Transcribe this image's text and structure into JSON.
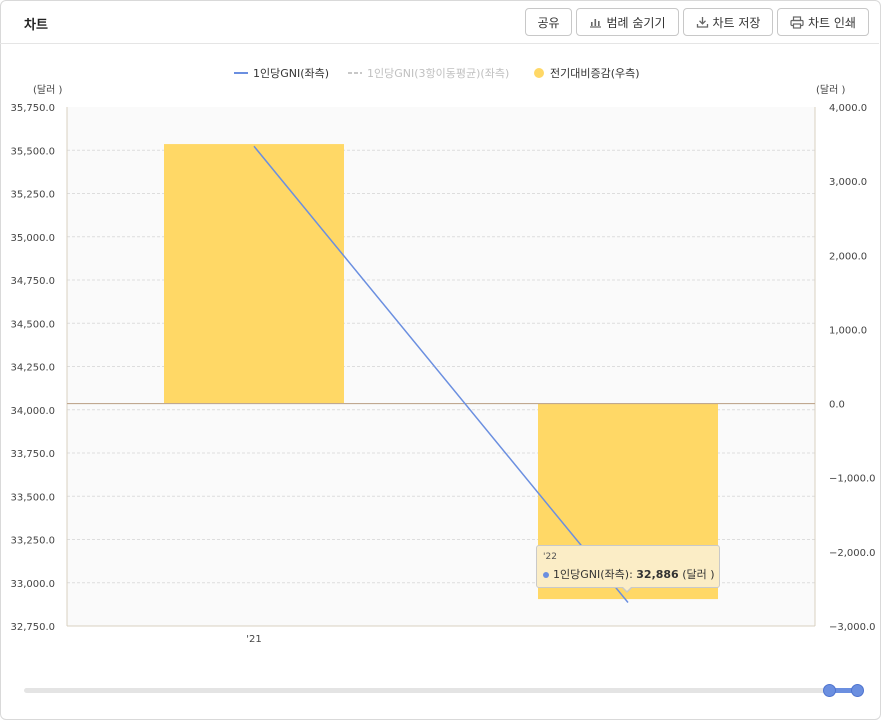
{
  "header": {
    "title": "차트",
    "buttons": {
      "share": "공유",
      "legend_hide": "범례 숨기기",
      "save_chart": "차트 저장",
      "print_chart": "차트 인쇄"
    }
  },
  "chart_data": {
    "type": "bar",
    "categories": [
      "'21",
      "'22"
    ],
    "x_tick_labels": [
      "'21",
      ""
    ],
    "left_axis": {
      "unit_label": "(달러 )",
      "ylim": [
        32750,
        35750
      ],
      "ticks": [
        32750,
        33000,
        33250,
        33500,
        33750,
        34000,
        34250,
        34500,
        34750,
        35000,
        35250,
        35500,
        35750
      ]
    },
    "right_axis": {
      "unit_label": "(달러 )",
      "ylim": [
        -3000,
        4000
      ],
      "ticks": [
        -3000,
        -2000,
        -1000,
        0,
        1000,
        2000,
        3000,
        4000
      ]
    },
    "series": [
      {
        "name": "1인당GNI(좌측)",
        "type": "line",
        "axis": "left",
        "color": "#6b8fe0",
        "values": [
          35523,
          32886
        ]
      },
      {
        "name": "1인당GNI(3항이동평균)(좌측)",
        "type": "line",
        "axis": "left",
        "color": "#c8c8c8",
        "dashed": true,
        "hidden": true,
        "values": []
      },
      {
        "name": "전기대비증감(우측)",
        "type": "bar",
        "axis": "right",
        "color": "#ffd866",
        "values": [
          3500,
          -2637
        ]
      }
    ],
    "grid": true,
    "legend_position": "top"
  },
  "tooltip": {
    "x": "'22",
    "series": "1인당GNI(좌측)",
    "value": "32,886",
    "unit": "(달러 )"
  }
}
